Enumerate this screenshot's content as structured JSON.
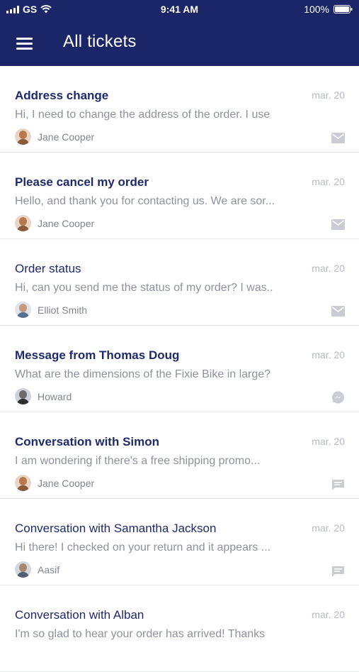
{
  "status_bar": {
    "carrier": "GS",
    "time": "9:41 AM",
    "battery": "100%"
  },
  "header": {
    "title": "All tickets"
  },
  "colors": {
    "header_bg": "#1a2667",
    "title_text": "#1e2a6b",
    "muted_text": "#8d929e",
    "icon_gray": "#c9ccd3"
  },
  "tickets": [
    {
      "title": "Address change",
      "date": "mar. 20",
      "preview": "Hi, I need to change the address of the order. I use",
      "author": "Jane Cooper",
      "channel_icon": "mail-icon"
    },
    {
      "title": "Please cancel my order",
      "date": "mar. 20",
      "preview": "Hello, and thank you for contacting us. We are sor...",
      "author": "Jane Cooper",
      "channel_icon": "mail-icon"
    },
    {
      "title": "Order status",
      "date": "mar. 20",
      "preview": "Hi, can you send me the status of my order? I was..",
      "author": "Elliot Smith",
      "channel_icon": "mail-icon"
    },
    {
      "title": "Message from Thomas Doug",
      "date": "mar. 20",
      "preview": "What are the dimensions of the Fixie Bike in large?",
      "author": "Howard",
      "channel_icon": "messenger-icon"
    },
    {
      "title": "Conversation with Simon",
      "date": "mar. 20",
      "preview": "I am wondering if there's a free shipping promo...",
      "author": "Jane Cooper",
      "channel_icon": "chat-icon"
    },
    {
      "title": "Conversation with Samantha Jackson",
      "date": "mar. 20",
      "preview": "Hi there! I checked on your return and it appears ...",
      "author": "Aasif",
      "channel_icon": "chat-icon"
    },
    {
      "title": "Conversation with Alban",
      "date": "mar. 20",
      "preview": "I'm so glad to hear your order has arrived! Thanks",
      "author": "",
      "channel_icon": ""
    }
  ]
}
